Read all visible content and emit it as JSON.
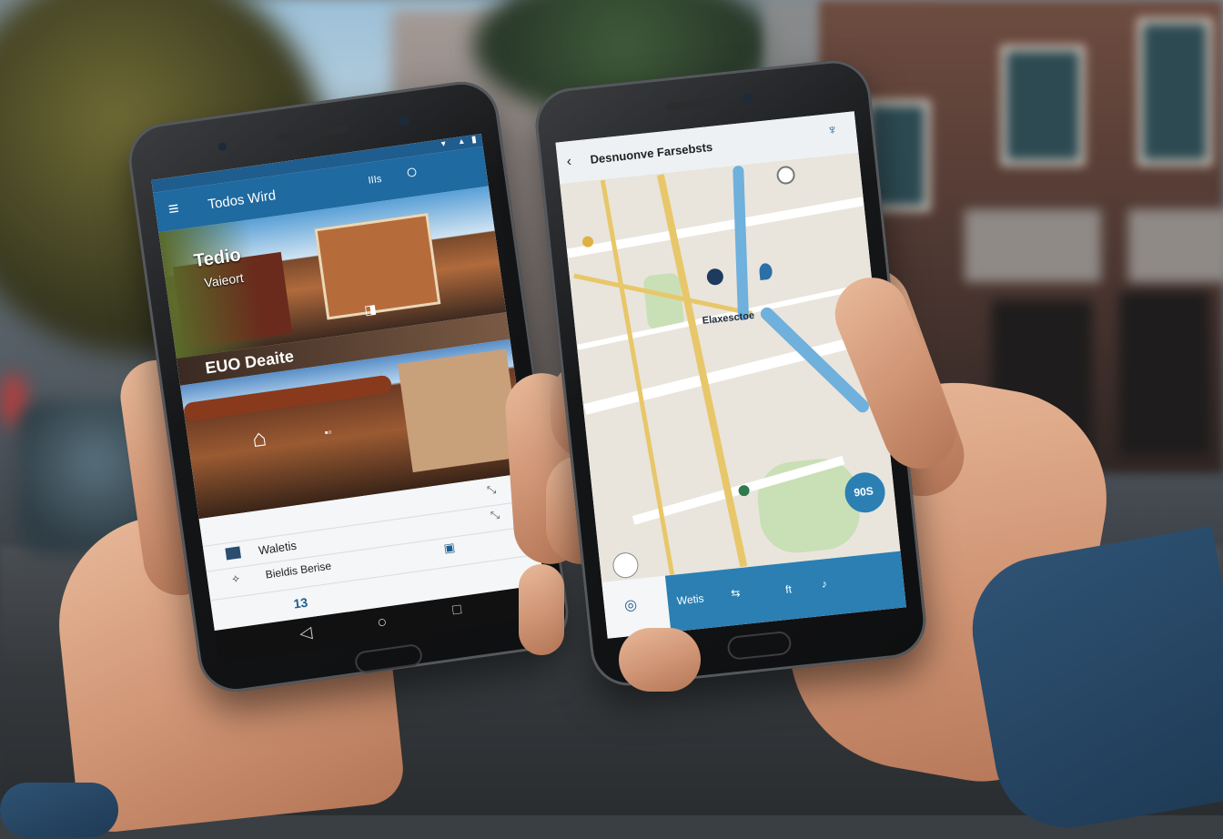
{
  "left_phone": {
    "app_title": "Todos Wird",
    "status_icon_text": "IIIs",
    "hero_caption_line1": "Tedio",
    "hero_caption_line2": "Vaieort",
    "photo_caption": "EUO Deaite",
    "list_item_1": "Waletis",
    "list_item_2": "Bieldis Berise",
    "list_footer": "13"
  },
  "right_phone": {
    "app_title": "Desnuonve Farsebsts",
    "fab_label": "90S",
    "bottom_tab_1": "Wetis",
    "bottom_tab_2": "ft",
    "map_label": "Elaxesctoe"
  },
  "colors": {
    "accent_blue": "#1f6aa0",
    "map_river": "#6fb0dc",
    "map_road_yellow": "#e8c76a"
  },
  "icons": [
    "menu-icon",
    "share-icon",
    "back-icon",
    "mic-icon",
    "location-pin-icon",
    "home-icon",
    "recent-apps-icon",
    "back-arrow-icon"
  ]
}
